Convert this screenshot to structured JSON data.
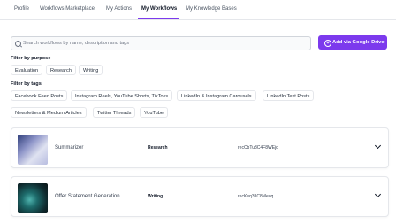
{
  "tabs": [
    {
      "label": "Profile"
    },
    {
      "label": "Workflows Marketplace"
    },
    {
      "label": "My Actions"
    },
    {
      "label": "My Workflows"
    },
    {
      "label": "My Knowledge Bases"
    }
  ],
  "active_tab": "My Workflows",
  "search": {
    "placeholder": "Search workflows by name, description and tags"
  },
  "add_button": {
    "label": "Add via Google Drive"
  },
  "filter_purpose": {
    "label": "Filter by purpose",
    "options": [
      "Evaluation",
      "Research",
      "Writing"
    ]
  },
  "filter_tags": {
    "label": "Filter by tags",
    "options": [
      "Facebook Feed Posts",
      "Instagram Reels, YouTube Shorts, TikToks",
      "LinkedIn & Instagram Carousels",
      "LinkedIn Text Posts",
      "Newsletters & Medium Articles",
      "Twitter Threads",
      "YouTube"
    ]
  },
  "workflows": [
    {
      "name": "Summarizer",
      "tag": "Research",
      "id": "recCbTu8C4F8WEjc"
    },
    {
      "name": "Offer Statement Generation",
      "tag": "Writing",
      "id": "recKeq3fIC8Meuq"
    }
  ],
  "colors": {
    "accent": "#7c3aed"
  }
}
